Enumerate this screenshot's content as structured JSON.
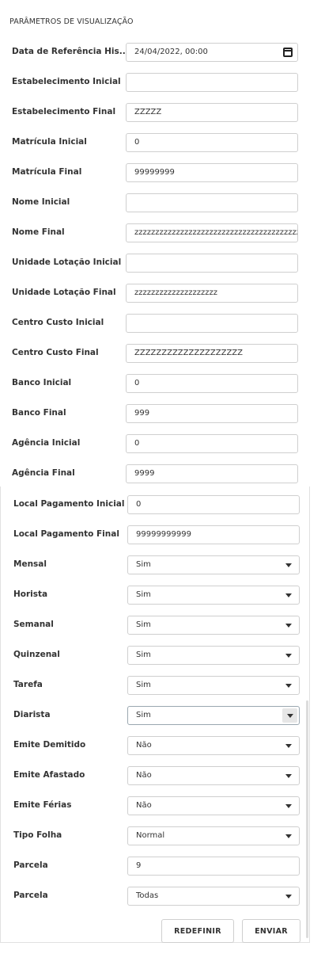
{
  "section_title": "PARÂMETROS DE VISUALIZAÇÃO",
  "fields": [
    {
      "label": "Data de Referência His...",
      "value": "24/04/2022, 00:00",
      "type": "datetime"
    },
    {
      "label": "Estabelecimento Inicial",
      "value": "",
      "type": "text"
    },
    {
      "label": "Estabelecimento Final",
      "value": "ZZZZZ",
      "type": "text"
    },
    {
      "label": "Matrícula Inicial",
      "value": "0",
      "type": "text"
    },
    {
      "label": "Matrícula Final",
      "value": "99999999",
      "type": "text"
    },
    {
      "label": "Nome Inicial",
      "value": "",
      "type": "text"
    },
    {
      "label": "Nome Final",
      "value": "zzzzzzzzzzzzzzzzzzzzzzzzzzzzzzzzzzzzzzzz",
      "type": "text"
    },
    {
      "label": "Unidade Lotação Inicial",
      "value": "",
      "type": "text"
    },
    {
      "label": "Unidade Lotação Final",
      "value": "zzzzzzzzzzzzzzzzzzzz",
      "type": "text"
    },
    {
      "label": "Centro Custo Inicial",
      "value": "",
      "type": "text"
    },
    {
      "label": "Centro Custo Final",
      "value": "ZZZZZZZZZZZZZZZZZZZZ",
      "type": "text"
    },
    {
      "label": "Banco Inicial",
      "value": "0",
      "type": "text"
    },
    {
      "label": "Banco Final",
      "value": "999",
      "type": "text"
    },
    {
      "label": "Agência Inicial",
      "value": "0",
      "type": "text"
    },
    {
      "label": "Agência Final",
      "value": "9999",
      "type": "text"
    }
  ],
  "lower_fields": [
    {
      "label": "Local Pagamento Inicial",
      "value": "0",
      "type": "text"
    },
    {
      "label": "Local Pagamento Final",
      "value": "99999999999",
      "type": "text"
    },
    {
      "label": "Mensal",
      "value": "Sim",
      "type": "select"
    },
    {
      "label": "Horista",
      "value": "Sim",
      "type": "select"
    },
    {
      "label": "Semanal",
      "value": "Sim",
      "type": "select"
    },
    {
      "label": "Quinzenal",
      "value": "Sim",
      "type": "select"
    },
    {
      "label": "Tarefa",
      "value": "Sim",
      "type": "select"
    },
    {
      "label": "Diarista",
      "value": "Sim",
      "type": "select-hover"
    },
    {
      "label": "Emite Demitido",
      "value": "Não",
      "type": "select"
    },
    {
      "label": "Emite Afastado",
      "value": "Não",
      "type": "select"
    },
    {
      "label": "Emite Férias",
      "value": "Não",
      "type": "select"
    },
    {
      "label": "Tipo Folha",
      "value": "Normal",
      "type": "select"
    },
    {
      "label": "Parcela",
      "value": "9",
      "type": "text"
    },
    {
      "label": "Parcela",
      "value": "Todas",
      "type": "select"
    }
  ],
  "buttons": {
    "reset": "REDEFINIR",
    "submit": "ENVIAR"
  },
  "icons": {
    "calendar": "calendar-icon",
    "dropdown": "chevron-down-icon"
  }
}
